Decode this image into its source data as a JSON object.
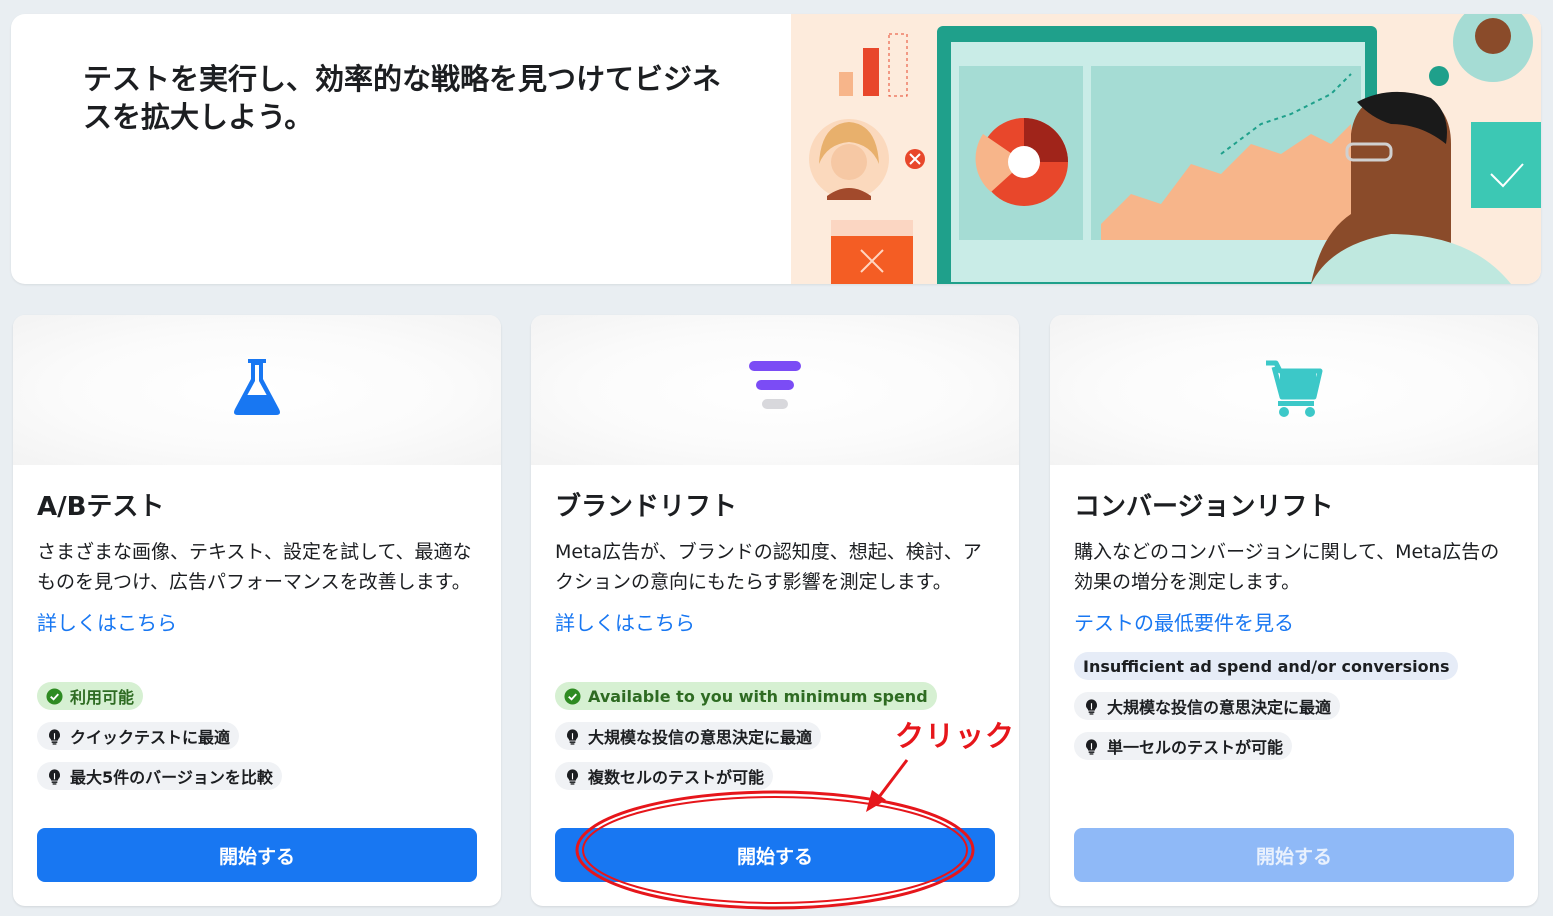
{
  "hero": {
    "title": "テストを実行し、効率的な戦略を見つけてビジネスを拡大しよう。"
  },
  "cards": [
    {
      "icon": "flask-icon",
      "icon_color": "#1877f2",
      "title": "A/Bテスト",
      "description": "さまざまな画像、テキスト、設定を試して、最適なものを見つけ、広告パフォーマンスを改善します。",
      "link": "詳しくはこちら",
      "chips": [
        {
          "text": "利用可能",
          "kind": "available",
          "icon": "check-circle-icon"
        },
        {
          "text": "クイックテストに最適",
          "kind": "tip",
          "icon": "lightbulb-icon"
        },
        {
          "text": "最大5件のバージョンを比較",
          "kind": "tip",
          "icon": "lightbulb-icon"
        }
      ],
      "button": "開始する",
      "button_enabled": true
    },
    {
      "icon": "funnel-lines-icon",
      "icon_color": "#7b4cf5",
      "title": "ブランドリフト",
      "description": "Meta広告が、ブランドの認知度、想起、検討、アクションの意向にもたらす影響を測定します。",
      "link": "詳しくはこちら",
      "chips": [
        {
          "text": "Available to you with minimum spend",
          "kind": "available",
          "icon": "check-circle-icon"
        },
        {
          "text": "大規模な投信の意思決定に最適",
          "kind": "tip",
          "icon": "lightbulb-icon"
        },
        {
          "text": "複数セルのテストが可能",
          "kind": "tip",
          "icon": "lightbulb-icon"
        }
      ],
      "button": "開始する",
      "button_enabled": true
    },
    {
      "icon": "shopping-cart-icon",
      "icon_color": "#3cc8c8",
      "title": "コンバージョンリフト",
      "description": "購入などのコンバージョンに関して、Meta広告の効果の増分を測定します。",
      "link": "テストの最低要件を見る",
      "chips": [
        {
          "text": "Insufficient ad spend and/or conversions",
          "kind": "notice",
          "icon": ""
        },
        {
          "text": "大規模な投信の意思決定に最適",
          "kind": "tip",
          "icon": "lightbulb-icon"
        },
        {
          "text": "単一セルのテストが可能",
          "kind": "tip",
          "icon": "lightbulb-icon"
        }
      ],
      "button": "開始する",
      "button_enabled": false
    }
  ],
  "annotation": {
    "label": "クリック",
    "color": "#e6161b"
  }
}
